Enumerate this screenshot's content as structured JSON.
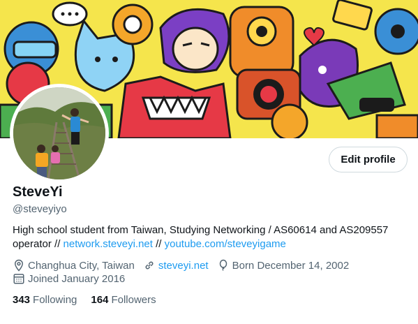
{
  "header": {
    "edit_profile_label": "Edit profile"
  },
  "profile": {
    "display_name": "SteveYi",
    "handle": "@steveyiyo",
    "bio_text": "High school student from Taiwan, Studying Networking / AS60614 and AS209557 operator // ",
    "bio_link1": "network.steveyi.net",
    "bio_sep": " // ",
    "bio_link2": "youtube.com/steveyigame",
    "location": "Changhua City, Taiwan",
    "website": "steveyi.net",
    "born": "Born December 14, 2002",
    "joined": "Joined January 2016"
  },
  "stats": {
    "following_count": "343",
    "following_label": "Following",
    "followers_count": "164",
    "followers_label": "Followers"
  },
  "colors": {
    "link": "#1d9bf0",
    "secondary_text": "#536471",
    "primary_text": "#0f1419",
    "border": "#cfd9de"
  },
  "icons": {
    "location": "location-pin-icon",
    "website": "link-icon",
    "born": "balloon-icon",
    "joined": "calendar-icon"
  }
}
